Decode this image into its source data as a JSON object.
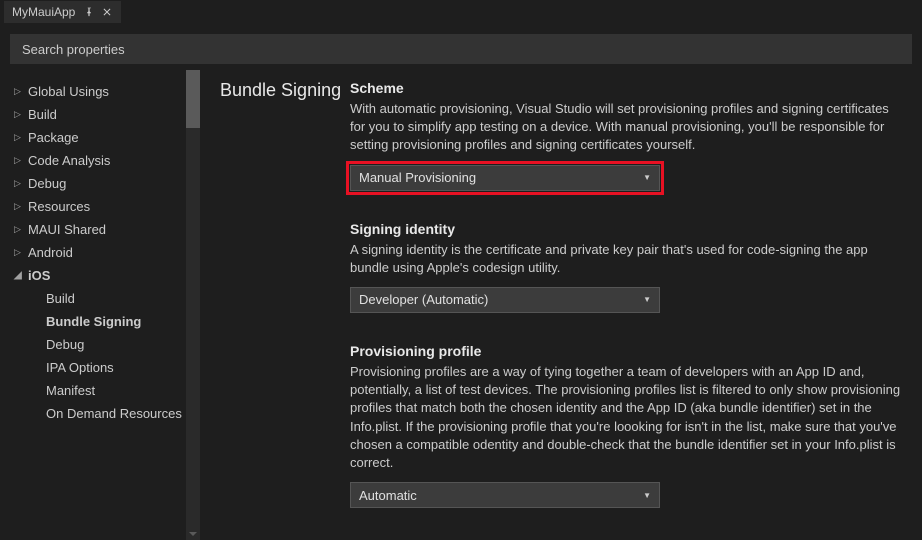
{
  "tab": {
    "title": "MyMauiApp"
  },
  "search": {
    "placeholder": "Search properties"
  },
  "sidebar": {
    "items": [
      {
        "label": "Global Usings",
        "expanded": false,
        "sub": false,
        "bold": false
      },
      {
        "label": "Build",
        "expanded": false,
        "sub": false,
        "bold": false
      },
      {
        "label": "Package",
        "expanded": false,
        "sub": false,
        "bold": false
      },
      {
        "label": "Code Analysis",
        "expanded": false,
        "sub": false,
        "bold": false
      },
      {
        "label": "Debug",
        "expanded": false,
        "sub": false,
        "bold": false
      },
      {
        "label": "Resources",
        "expanded": false,
        "sub": false,
        "bold": false
      },
      {
        "label": "MAUI Shared",
        "expanded": false,
        "sub": false,
        "bold": false
      },
      {
        "label": "Android",
        "expanded": false,
        "sub": false,
        "bold": false
      },
      {
        "label": "iOS",
        "expanded": true,
        "sub": false,
        "bold": true
      },
      {
        "label": "Build",
        "expanded": null,
        "sub": true,
        "bold": false
      },
      {
        "label": "Bundle Signing",
        "expanded": null,
        "sub": true,
        "bold": true
      },
      {
        "label": "Debug",
        "expanded": null,
        "sub": true,
        "bold": false
      },
      {
        "label": "IPA Options",
        "expanded": null,
        "sub": true,
        "bold": false
      },
      {
        "label": "Manifest",
        "expanded": null,
        "sub": true,
        "bold": false
      },
      {
        "label": "On Demand Resources",
        "expanded": null,
        "sub": true,
        "bold": false
      }
    ]
  },
  "section": {
    "title": "Bundle Signing"
  },
  "settings": {
    "scheme": {
      "label": "Scheme",
      "desc": "With automatic provisioning, Visual Studio will set provisioning profiles and signing certificates for you to simplify app testing on a device. With manual provisioning, you'll be responsible for setting provisioning profiles and signing certificates yourself.",
      "value": "Manual Provisioning"
    },
    "identity": {
      "label": "Signing identity",
      "desc": "A signing identity is the certificate and private key pair that's used for code-signing the app bundle using Apple's codesign utility.",
      "value": "Developer (Automatic)"
    },
    "profile": {
      "label": "Provisioning profile",
      "desc": "Provisioning profiles are a way of tying together a team of developers with an App ID and, potentially, a list of test devices. The provisioning profiles list is filtered to only show provisioning profiles that match both the chosen identity and the App ID (aka bundle identifier) set in the Info.plist. If the provisioning profile that you're loooking for isn't in the list, make sure that you've chosen a compatible odentity and double-check that the bundle identifier set in your Info.plist is correct.",
      "value": "Automatic"
    }
  }
}
